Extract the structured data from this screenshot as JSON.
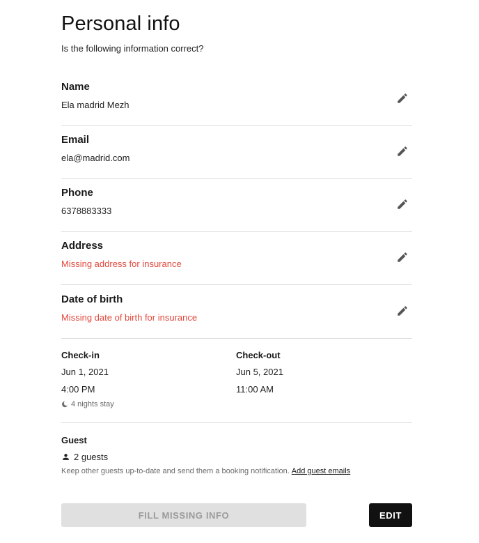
{
  "header": {
    "title": "Personal info",
    "subtitle": "Is the following information correct?"
  },
  "fields": [
    {
      "label": "Name",
      "value": "Ela madrid Mezh",
      "missing": false
    },
    {
      "label": "Email",
      "value": "ela@madrid.com",
      "missing": false
    },
    {
      "label": "Phone",
      "value": "6378883333",
      "missing": false
    },
    {
      "label": "Address",
      "value": "Missing address for insurance",
      "missing": true
    },
    {
      "label": "Date of birth",
      "value": "Missing date of birth for insurance",
      "missing": true
    }
  ],
  "icons": {
    "edit": "pencil-icon",
    "nights": "moon-icon",
    "guest": "person-icon"
  },
  "stay": {
    "checkin": {
      "label": "Check-in",
      "date": "Jun 1, 2021",
      "time": "4:00 PM"
    },
    "checkout": {
      "label": "Check-out",
      "date": "Jun 5, 2021",
      "time": "11:00 AM"
    },
    "nights": "4 nights stay"
  },
  "guest": {
    "label": "Guest",
    "count": "2 guests",
    "note": "Keep other guests up-to-date and send them a booking notification.",
    "link": "Add guest emails"
  },
  "actions": {
    "fill_missing": "FILL MISSING INFO",
    "edit": "EDIT"
  },
  "colors": {
    "missing": "#e2483d",
    "primary_button": "#111111",
    "disabled_button": "#e0e0e0",
    "icon": "#555555"
  }
}
